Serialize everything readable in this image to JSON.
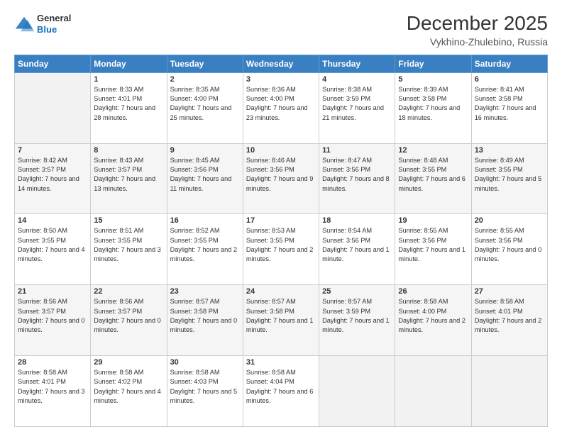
{
  "header": {
    "logo_general": "General",
    "logo_blue": "Blue",
    "title": "December 2025",
    "subtitle": "Vykhino-Zhulebino, Russia"
  },
  "days_of_week": [
    "Sunday",
    "Monday",
    "Tuesday",
    "Wednesday",
    "Thursday",
    "Friday",
    "Saturday"
  ],
  "weeks": [
    [
      {
        "day": "",
        "sunrise": "",
        "sunset": "",
        "daylight": ""
      },
      {
        "day": "1",
        "sunrise": "Sunrise: 8:33 AM",
        "sunset": "Sunset: 4:01 PM",
        "daylight": "Daylight: 7 hours and 28 minutes."
      },
      {
        "day": "2",
        "sunrise": "Sunrise: 8:35 AM",
        "sunset": "Sunset: 4:00 PM",
        "daylight": "Daylight: 7 hours and 25 minutes."
      },
      {
        "day": "3",
        "sunrise": "Sunrise: 8:36 AM",
        "sunset": "Sunset: 4:00 PM",
        "daylight": "Daylight: 7 hours and 23 minutes."
      },
      {
        "day": "4",
        "sunrise": "Sunrise: 8:38 AM",
        "sunset": "Sunset: 3:59 PM",
        "daylight": "Daylight: 7 hours and 21 minutes."
      },
      {
        "day": "5",
        "sunrise": "Sunrise: 8:39 AM",
        "sunset": "Sunset: 3:58 PM",
        "daylight": "Daylight: 7 hours and 18 minutes."
      },
      {
        "day": "6",
        "sunrise": "Sunrise: 8:41 AM",
        "sunset": "Sunset: 3:58 PM",
        "daylight": "Daylight: 7 hours and 16 minutes."
      }
    ],
    [
      {
        "day": "7",
        "sunrise": "Sunrise: 8:42 AM",
        "sunset": "Sunset: 3:57 PM",
        "daylight": "Daylight: 7 hours and 14 minutes."
      },
      {
        "day": "8",
        "sunrise": "Sunrise: 8:43 AM",
        "sunset": "Sunset: 3:57 PM",
        "daylight": "Daylight: 7 hours and 13 minutes."
      },
      {
        "day": "9",
        "sunrise": "Sunrise: 8:45 AM",
        "sunset": "Sunset: 3:56 PM",
        "daylight": "Daylight: 7 hours and 11 minutes."
      },
      {
        "day": "10",
        "sunrise": "Sunrise: 8:46 AM",
        "sunset": "Sunset: 3:56 PM",
        "daylight": "Daylight: 7 hours and 9 minutes."
      },
      {
        "day": "11",
        "sunrise": "Sunrise: 8:47 AM",
        "sunset": "Sunset: 3:56 PM",
        "daylight": "Daylight: 7 hours and 8 minutes."
      },
      {
        "day": "12",
        "sunrise": "Sunrise: 8:48 AM",
        "sunset": "Sunset: 3:55 PM",
        "daylight": "Daylight: 7 hours and 6 minutes."
      },
      {
        "day": "13",
        "sunrise": "Sunrise: 8:49 AM",
        "sunset": "Sunset: 3:55 PM",
        "daylight": "Daylight: 7 hours and 5 minutes."
      }
    ],
    [
      {
        "day": "14",
        "sunrise": "Sunrise: 8:50 AM",
        "sunset": "Sunset: 3:55 PM",
        "daylight": "Daylight: 7 hours and 4 minutes."
      },
      {
        "day": "15",
        "sunrise": "Sunrise: 8:51 AM",
        "sunset": "Sunset: 3:55 PM",
        "daylight": "Daylight: 7 hours and 3 minutes."
      },
      {
        "day": "16",
        "sunrise": "Sunrise: 8:52 AM",
        "sunset": "Sunset: 3:55 PM",
        "daylight": "Daylight: 7 hours and 2 minutes."
      },
      {
        "day": "17",
        "sunrise": "Sunrise: 8:53 AM",
        "sunset": "Sunset: 3:55 PM",
        "daylight": "Daylight: 7 hours and 2 minutes."
      },
      {
        "day": "18",
        "sunrise": "Sunrise: 8:54 AM",
        "sunset": "Sunset: 3:56 PM",
        "daylight": "Daylight: 7 hours and 1 minute."
      },
      {
        "day": "19",
        "sunrise": "Sunrise: 8:55 AM",
        "sunset": "Sunset: 3:56 PM",
        "daylight": "Daylight: 7 hours and 1 minute."
      },
      {
        "day": "20",
        "sunrise": "Sunrise: 8:55 AM",
        "sunset": "Sunset: 3:56 PM",
        "daylight": "Daylight: 7 hours and 0 minutes."
      }
    ],
    [
      {
        "day": "21",
        "sunrise": "Sunrise: 8:56 AM",
        "sunset": "Sunset: 3:57 PM",
        "daylight": "Daylight: 7 hours and 0 minutes."
      },
      {
        "day": "22",
        "sunrise": "Sunrise: 8:56 AM",
        "sunset": "Sunset: 3:57 PM",
        "daylight": "Daylight: 7 hours and 0 minutes."
      },
      {
        "day": "23",
        "sunrise": "Sunrise: 8:57 AM",
        "sunset": "Sunset: 3:58 PM",
        "daylight": "Daylight: 7 hours and 0 minutes."
      },
      {
        "day": "24",
        "sunrise": "Sunrise: 8:57 AM",
        "sunset": "Sunset: 3:58 PM",
        "daylight": "Daylight: 7 hours and 1 minute."
      },
      {
        "day": "25",
        "sunrise": "Sunrise: 8:57 AM",
        "sunset": "Sunset: 3:59 PM",
        "daylight": "Daylight: 7 hours and 1 minute."
      },
      {
        "day": "26",
        "sunrise": "Sunrise: 8:58 AM",
        "sunset": "Sunset: 4:00 PM",
        "daylight": "Daylight: 7 hours and 2 minutes."
      },
      {
        "day": "27",
        "sunrise": "Sunrise: 8:58 AM",
        "sunset": "Sunset: 4:01 PM",
        "daylight": "Daylight: 7 hours and 2 minutes."
      }
    ],
    [
      {
        "day": "28",
        "sunrise": "Sunrise: 8:58 AM",
        "sunset": "Sunset: 4:01 PM",
        "daylight": "Daylight: 7 hours and 3 minutes."
      },
      {
        "day": "29",
        "sunrise": "Sunrise: 8:58 AM",
        "sunset": "Sunset: 4:02 PM",
        "daylight": "Daylight: 7 hours and 4 minutes."
      },
      {
        "day": "30",
        "sunrise": "Sunrise: 8:58 AM",
        "sunset": "Sunset: 4:03 PM",
        "daylight": "Daylight: 7 hours and 5 minutes."
      },
      {
        "day": "31",
        "sunrise": "Sunrise: 8:58 AM",
        "sunset": "Sunset: 4:04 PM",
        "daylight": "Daylight: 7 hours and 6 minutes."
      },
      {
        "day": "",
        "sunrise": "",
        "sunset": "",
        "daylight": ""
      },
      {
        "day": "",
        "sunrise": "",
        "sunset": "",
        "daylight": ""
      },
      {
        "day": "",
        "sunrise": "",
        "sunset": "",
        "daylight": ""
      }
    ]
  ]
}
